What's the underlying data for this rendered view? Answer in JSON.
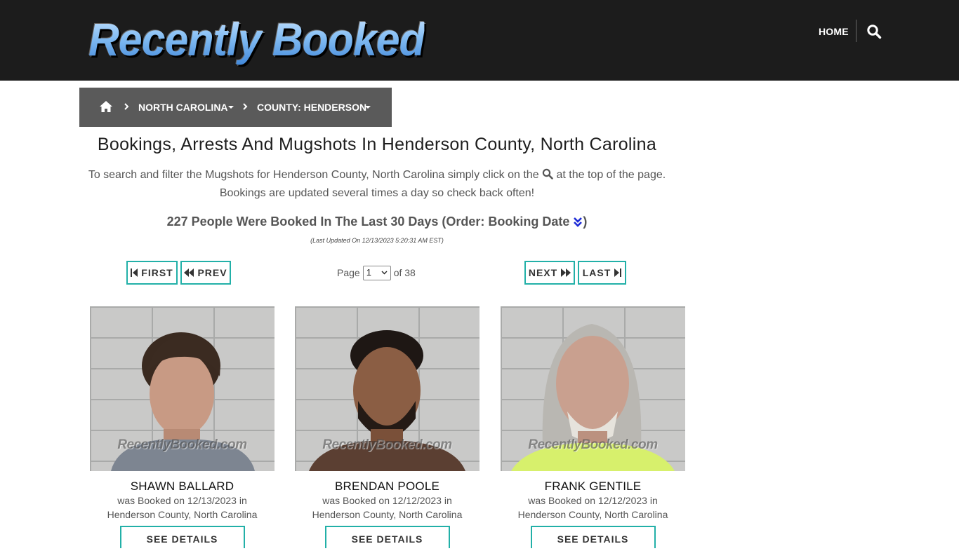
{
  "header": {
    "logo_text": "Recently Booked",
    "nav_home": "HOME",
    "search_icon": "search-icon"
  },
  "breadcrumb": {
    "home_icon": "home-icon",
    "state": "NORTH CAROLINA",
    "county": "COUNTY: HENDERSON"
  },
  "page": {
    "title": "Bookings, Arrests And Mugshots In Henderson County, North Carolina",
    "intro_part1": "To search and filter the Mugshots for Henderson County, North Carolina simply click on the",
    "intro_part2": "at the top of the page. Bookings are updated several times a day so check back often!",
    "count_text": "227 People Were Booked In The Last 30 Days (Order: Booking Date",
    "count_close": ")",
    "updated": "(Last Updated On 12/13/2023 5:20:31 AM EST)"
  },
  "pager": {
    "first": "FIRST",
    "prev": "PREV",
    "next": "NEXT",
    "last": "LAST",
    "page_label": "Page",
    "page_value": "1",
    "of_label": "of 38"
  },
  "cards": [
    {
      "name": "SHAWN BALLARD",
      "booked_line1": "was Booked on 12/13/2023 in",
      "booked_line2": "Henderson County, North Carolina",
      "details": "SEE DETAILS",
      "watermark": "RecentlyBooked.com"
    },
    {
      "name": "BRENDAN POOLE",
      "booked_line1": "was Booked on 12/12/2023 in",
      "booked_line2": "Henderson County, North Carolina",
      "details": "SEE DETAILS",
      "watermark": "RecentlyBooked.com"
    },
    {
      "name": "FRANK GENTILE",
      "booked_line1": "was Booked on 12/12/2023 in",
      "booked_line2": "Henderson County, North Carolina",
      "details": "SEE DETAILS",
      "watermark": "RecentlyBooked.com"
    }
  ],
  "colors": {
    "header_bg": "#1c1c1c",
    "breadcrumb_bg": "#5a5a5a",
    "accent_teal": "#22b0a8",
    "order_icon": "#1d2bd6"
  }
}
